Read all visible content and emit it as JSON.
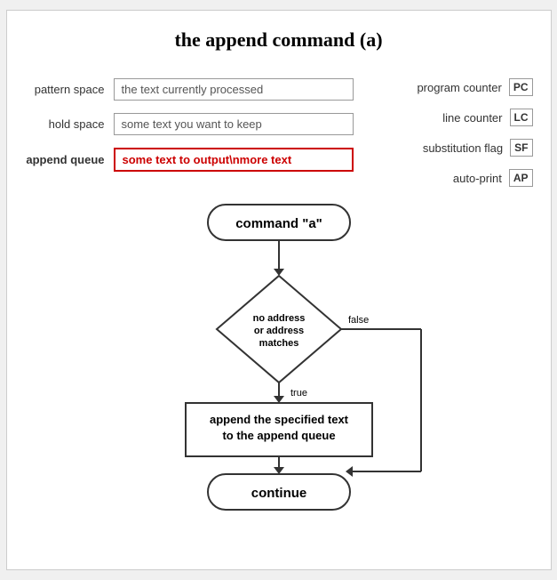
{
  "title": "the append command (a)",
  "registers": {
    "pattern_space": {
      "label": "pattern space",
      "value": "the text currently processed"
    },
    "hold_space": {
      "label": "hold space",
      "value": "some text you want to keep"
    },
    "append_queue": {
      "label": "append queue",
      "value": "some text to output\\nmore text",
      "highlighted": true
    }
  },
  "right_registers": [
    {
      "label": "program counter",
      "badge": "PC"
    },
    {
      "label": "line counter",
      "badge": "LC"
    },
    {
      "label": "substitution flag",
      "badge": "SF"
    },
    {
      "label": "auto-print",
      "badge": "AP"
    }
  ],
  "flowchart": {
    "command_box": "command \"a\"",
    "decision": "no address\nor address\nmatches",
    "false_label": "false",
    "true_label": "true",
    "action_box": "append the specified text\nto the append queue",
    "continue_box": "continue"
  }
}
